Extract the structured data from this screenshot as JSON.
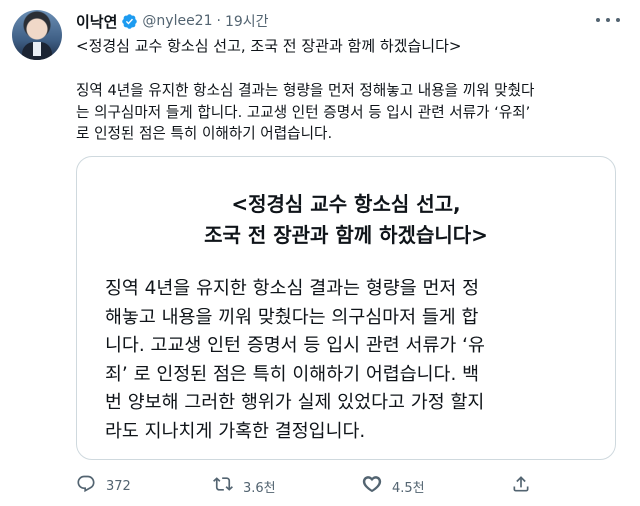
{
  "tweet": {
    "author_name": "이낙연",
    "handle": "@nylee21",
    "separator": "·",
    "time": "19시간",
    "title": "<정경심 교수 항소심 선고, 조국 전 장관과 함께 하겠습니다>",
    "body_lines": [
      "징역 4년을 유지한 항소심 결과는 형량을 먼저 정해놓고 내용을 끼워 맞췄다",
      "는 의구심마저 들게 합니다. 고교생 인턴 증명서 등 입시 관련 서류가 ‘유죄’",
      "로 인정된 점은 특히 이해하기 어렵습니다."
    ]
  },
  "card": {
    "title_lines": [
      "<정경심 교수 항소심 선고,",
      "조국 전 장관과 함께 하겠습니다>"
    ],
    "body_lines": [
      "징역 4년을 유지한 항소심 결과는 형량을 먼저 정",
      "해놓고 내용을 끼워 맞췄다는 의구심마저 들게 합",
      "니다. 고교생 인턴 증명서 등 입시 관련 서류가 ‘유",
      "죄’ 로 인정된 점은 특히 이해하기 어렵습니다. 백",
      "번 양보해 그러한 행위가 실제 있었다고 가정 할지",
      "라도 지나치게 가혹한 결정입니다."
    ]
  },
  "actions": {
    "reply_count": "372",
    "retweet_count": "3.6천",
    "like_count": "4.5천",
    "share_count": ""
  },
  "colors": {
    "verified_badge": "#1d9bf0",
    "secondary_text": "#536471",
    "border": "#cfd9de"
  },
  "icons": [
    "verified-icon",
    "more-icon",
    "reply-icon",
    "retweet-icon",
    "like-icon",
    "share-icon"
  ]
}
